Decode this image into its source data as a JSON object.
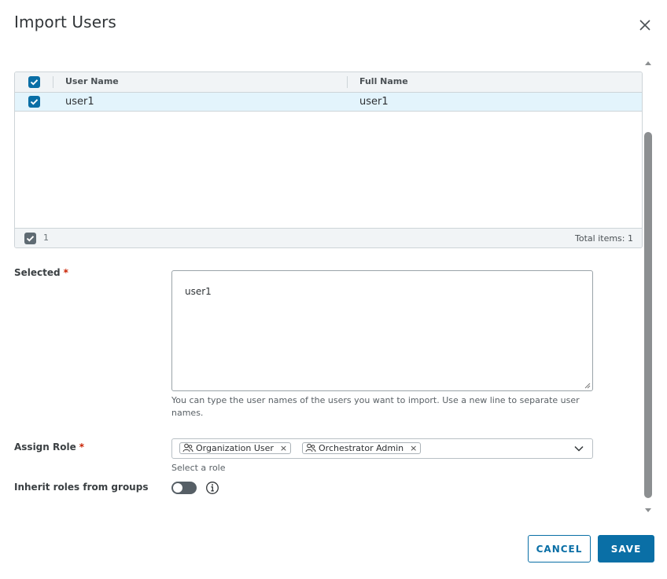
{
  "dialog": {
    "title": "Import Users",
    "close_icon": "close-icon"
  },
  "grid": {
    "columns": [
      "User Name",
      "Full Name"
    ],
    "rows": [
      {
        "selected": true,
        "user_name": "user1",
        "full_name": "user1"
      }
    ],
    "footer": {
      "selected_count": "1",
      "total_label": "Total items: 1"
    }
  },
  "form": {
    "selected": {
      "label": "Selected",
      "required_mark": "*",
      "value": "user1",
      "helper": "You can type the user names of the users you want to import. Use a new line to separate user names."
    },
    "assign_role": {
      "label": "Assign Role",
      "required_mark": "*",
      "chips": [
        "Organization User",
        "Orchestrator Admin"
      ],
      "chip_remove": "×",
      "helper": "Select a role"
    },
    "inherit_roles": {
      "label": "Inherit roles from groups",
      "enabled": false
    }
  },
  "buttons": {
    "cancel": "CANCEL",
    "save": "SAVE"
  },
  "colors": {
    "accent": "#0a6fa6",
    "selected_row": "#e3f4fc",
    "required": "#c92100"
  }
}
